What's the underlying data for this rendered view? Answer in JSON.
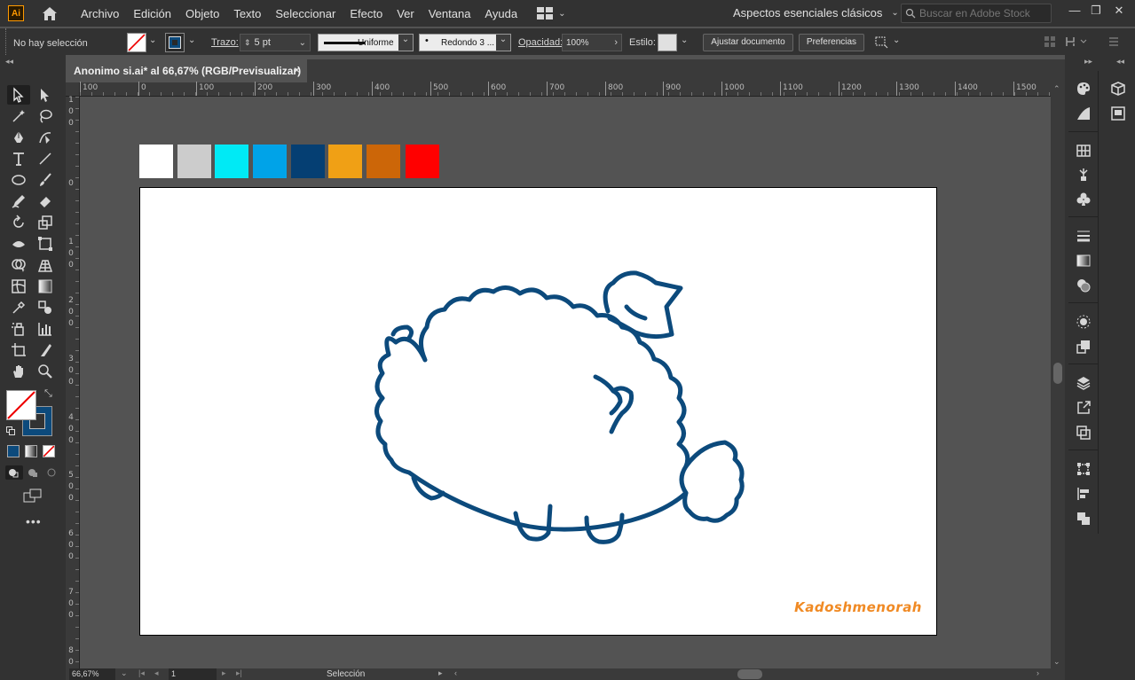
{
  "app": {
    "logo_text": "Ai",
    "menu": [
      "Archivo",
      "Edición",
      "Objeto",
      "Texto",
      "Seleccionar",
      "Efecto",
      "Ver",
      "Ventana",
      "Ayuda"
    ],
    "workspace": "Aspectos esenciales clásicos",
    "stock_search_placeholder": "Buscar en Adobe Stock",
    "window_controls": [
      "—",
      "❐",
      "✕"
    ]
  },
  "control_bar": {
    "selection_status": "No hay selección",
    "stroke_label": "Trazo:",
    "stroke_weight": "5 pt",
    "stroke_profile": "Uniforme",
    "brush": "Redondo 3 ...",
    "opacity_label": "Opacidad:",
    "opacity_value": "100%",
    "style_label": "Estilo:",
    "fit_document_button": "Ajustar documento",
    "preferences_button": "Preferencias"
  },
  "document": {
    "tab_title": "Anonimo si.ai* al 66,67% (RGB/Previsualizar)",
    "close": "×",
    "signature": "Kadoshmenorah"
  },
  "rulers": {
    "horizontal": [
      "100",
      "0",
      "100",
      "200",
      "300",
      "400",
      "500",
      "600",
      "700",
      "800",
      "900",
      "1000",
      "1100",
      "1200",
      "1300",
      "1400",
      "1500"
    ],
    "vertical": [
      "0",
      "1 0 0",
      "2 0 0",
      "3 0 0",
      "4 0 0",
      "5 0 0",
      "6 0 0",
      "7 0 0",
      "8 0 0"
    ],
    "vertical_first": "1 0 0"
  },
  "swatches": [
    "#ffffff",
    "#cccccc",
    "#00eaf5",
    "#00a3e8",
    "#053f73",
    "#f0a015",
    "#cc6608",
    "#ff0000"
  ],
  "colors": {
    "stroke_color": "#0c4a7c",
    "accent": "#f08a24"
  },
  "status_bar": {
    "zoom": "66,67%",
    "page": "1",
    "status_text": "Selección"
  }
}
